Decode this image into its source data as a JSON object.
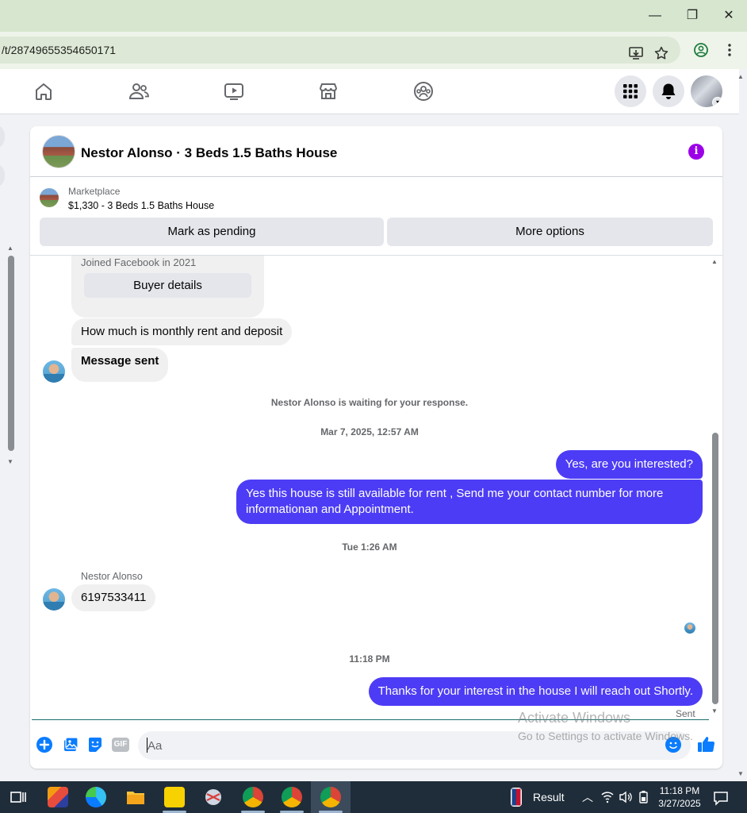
{
  "window": {
    "minimize": "—",
    "maximize": "❐",
    "close": "✕"
  },
  "browser": {
    "url": "/t/28749655354650171",
    "icons": [
      "install-app-icon",
      "bookmark-star-icon",
      "profile-icon",
      "kebab-menu-icon"
    ]
  },
  "fbnav": {
    "icons": [
      "home-icon",
      "friends-icon",
      "watch-icon",
      "marketplace-icon",
      "groups-icon",
      "menu-grid-icon",
      "notifications-icon",
      "account-avatar"
    ]
  },
  "chat": {
    "title": "Nestor Alonso · 3 Beds 1.5 Baths House",
    "info_icon": "i",
    "marketplace": {
      "label": "Marketplace",
      "listing": "$1,330 - 3 Beds 1.5 Baths House",
      "mark_pending": "Mark as pending",
      "more_options": "More options"
    },
    "card": {
      "joined": "Joined Facebook in 2021",
      "buyer_details": "Buyer details"
    },
    "messages": {
      "in1": "How much is monthly rent and deposit",
      "in2": "Message sent",
      "waiting": "Nestor Alonso is waiting for your response.",
      "ts1": "Mar 7, 2025, 12:57 AM",
      "out1": "Yes, are you interested?",
      "out2": "Yes this house is still available for rent , Send me your contact number for more informationan and Appointment.",
      "ts2": "Tue 1:26 AM",
      "sender": "Nestor Alonso",
      "in3": "6197533411",
      "ts3": "11:18 PM",
      "out3": "Thanks for your interest in the house I will reach out Shortly.",
      "status": "Sent"
    },
    "composer": {
      "placeholder": "Aa",
      "gif": "GIF"
    }
  },
  "watermark": {
    "line1": "Activate Windows",
    "line2": "Go to Settings to activate Windows."
  },
  "taskbar": {
    "result_label": "Result",
    "time": "11:18 PM",
    "date": "3/27/2025"
  },
  "colors": {
    "outgoing_bubble": "#4d3cf5",
    "incoming_bubble": "#f0f0f0",
    "facebook_blue": "#0a7cff",
    "info_purple": "#9b00e8"
  }
}
